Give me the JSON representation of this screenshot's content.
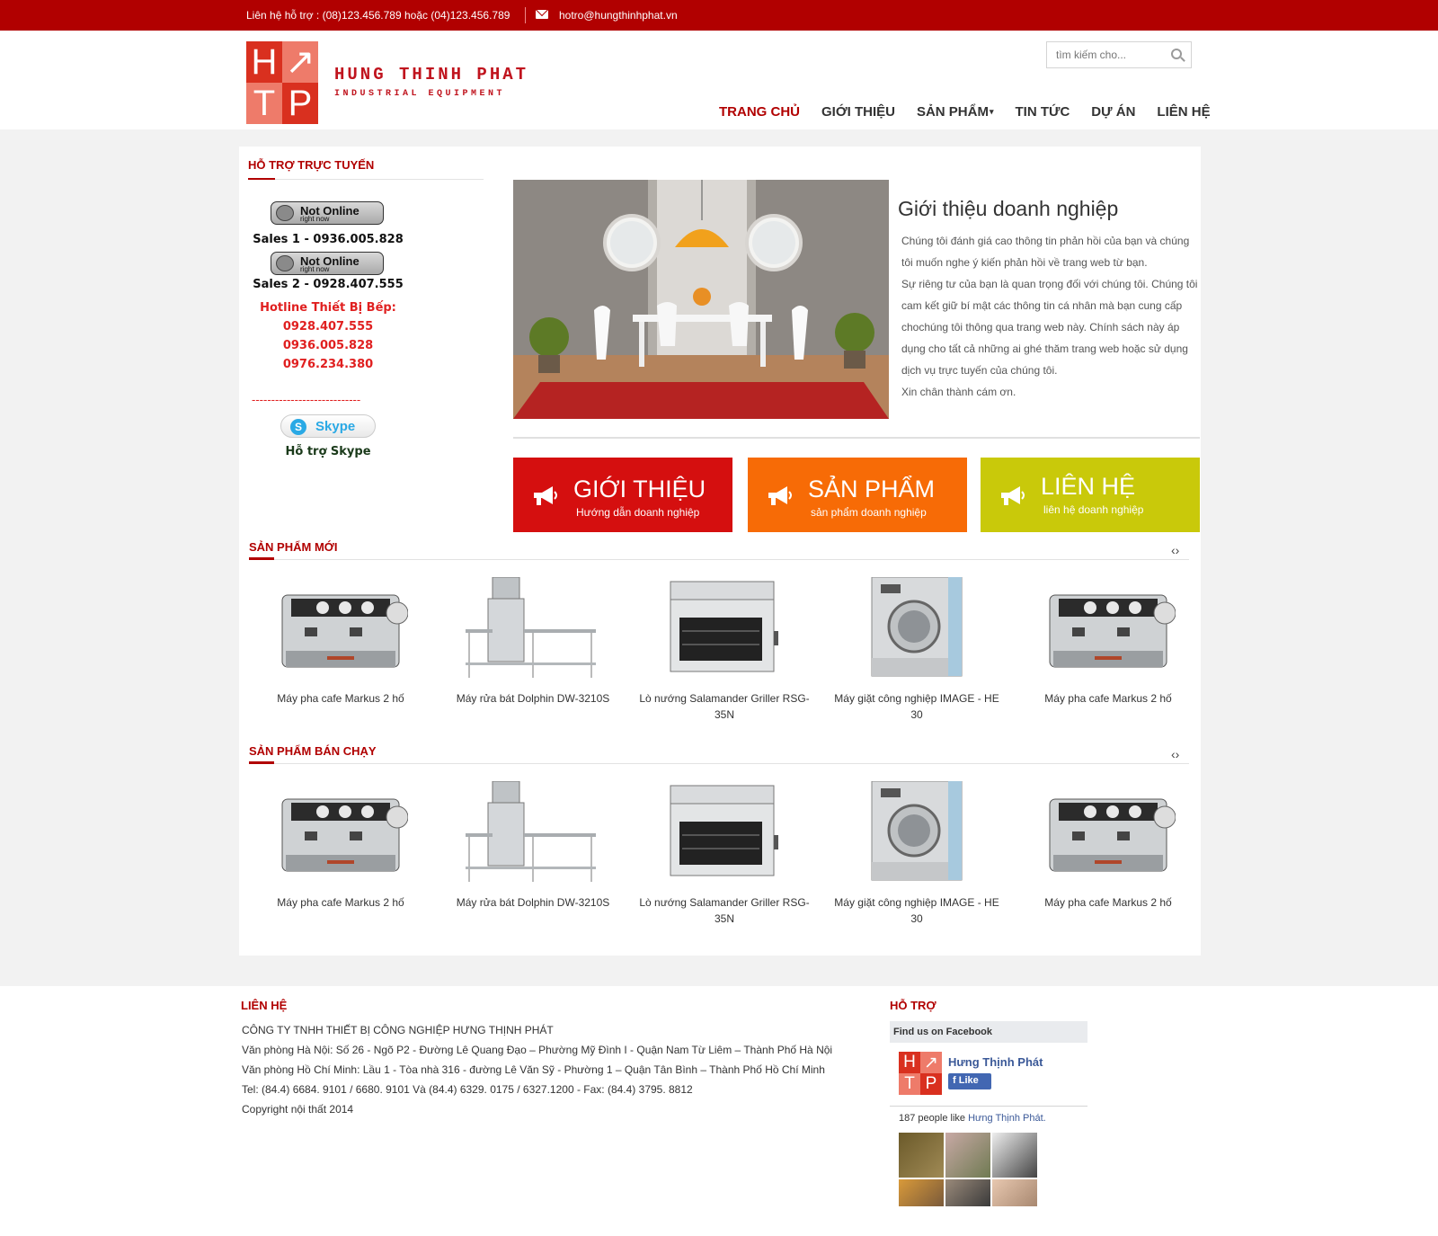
{
  "topbar": {
    "phone_text": "Liên hệ hỗ trợ :  (08)123.456.789 hoặc (04)123.456.789",
    "email": "hotro@hungthinhphat.vn"
  },
  "header": {
    "logo_letters": [
      "H",
      "↗",
      "T",
      "P"
    ],
    "brand_name": "HUNG THINH PHAT",
    "brand_sub": "INDUSTRIAL EQUIPMENT",
    "search_placeholder": "tìm kiếm cho...",
    "nav": [
      {
        "label": "TRANG CHỦ",
        "active": true
      },
      {
        "label": "GIỚI THIỆU"
      },
      {
        "label": "SẢN PHẨM",
        "has_dropdown": true
      },
      {
        "label": "TIN TỨC"
      },
      {
        "label": "DỰ ÁN"
      },
      {
        "label": "LIÊN HỆ"
      }
    ]
  },
  "sidebar": {
    "title": "HỖ TRỢ TRỰC TUYẾN",
    "status_line1": "Not Online",
    "status_line2": "right now",
    "sales1": "Sales 1 - 0936.005.828",
    "sales2": "Sales 2 - 0928.407.555",
    "hotline_title": "Hotline Thiết Bị Bếp:",
    "hotlines": [
      "0928.407.555",
      "0936.005.828",
      "0976.234.380"
    ],
    "dashes": "----------------------------",
    "skype_label": "Skype",
    "skype_caption": "Hỗ trợ Skype"
  },
  "intro": {
    "title": "Giới thiệu doanh nghiệp",
    "paragraphs": [
      "Chúng tôi đánh giá cao thông tin phản hồi của bạn và chúng tôi muốn nghe ý kiến phản hồi về trang web từ bạn.",
      "Sự riêng tư của bạn là quan trọng đối với chúng tôi. Chúng tôi cam kết giữ bí mật các thông tin cá nhân mà bạn cung cấp chochúng tôi thông qua trang web này. Chính sách này áp dụng cho tất cả những ai ghé thăm trang web hoặc sử dụng dịch vụ trực tuyến của chúng tôi.",
      "Xin chân thành cám ơn."
    ]
  },
  "tiles": [
    {
      "title": "GIỚI THIỆU",
      "subtitle": "Hướng dẫn doanh nghiệp",
      "color": "#d50f0f"
    },
    {
      "title": "SẢN PHẨM",
      "subtitle": "sản phẩm doanh nghiệp",
      "color": "#f76b06"
    },
    {
      "title": "LIÊN HỆ",
      "subtitle": "liên hệ doanh nghiệp",
      "color": "#c9c90a"
    }
  ],
  "new_products": {
    "title": "SẢN PHẨM MỚI",
    "arrows": "‹›",
    "items": [
      {
        "name": "Máy pha cafe Markus 2 hố",
        "image": "espresso-machine"
      },
      {
        "name": "Máy rửa bát Dolphin DW-3210S",
        "image": "dishwasher"
      },
      {
        "name": "Lò nướng Salamander Griller RSG-35N",
        "image": "salamander-oven"
      },
      {
        "name": "Máy giặt công nghiệp IMAGE - HE 30",
        "image": "washing-machine"
      },
      {
        "name": "Máy pha cafe Markus 2 hố",
        "image": "espresso-machine"
      }
    ]
  },
  "best_sellers": {
    "title": "SẢN PHẨM BÁN CHẠY",
    "arrows": "‹›",
    "items": [
      {
        "name": "Máy pha cafe Markus 2 hố",
        "image": "espresso-machine"
      },
      {
        "name": "Máy rửa bát Dolphin DW-3210S",
        "image": "dishwasher"
      },
      {
        "name": "Lò nướng Salamander Griller RSG-35N",
        "image": "salamander-oven"
      },
      {
        "name": "Máy giặt công nghiệp IMAGE - HE 30",
        "image": "washing-machine"
      },
      {
        "name": "Máy pha cafe Markus 2 hố",
        "image": "espresso-machine"
      }
    ]
  },
  "footer": {
    "contact_title": "LIÊN HỆ",
    "lines": [
      "CÔNG TY TNHH THIẾT BỊ CÔNG NGHIỆP HƯNG THỊNH PHÁT",
      "Văn phòng Hà Nội: Số 26 - Ngõ P2 - Đường Lê Quang Đạo – Phường Mỹ Đình I - Quận Nam Từ Liêm – Thành Phố Hà Nội",
      "Văn phòng Hồ Chí Minh: Lầu 1 - Tòa nhà 316 - đường Lê Văn Sỹ - Phường 1 – Quận Tân Bình – Thành Phố Hồ Chí Minh",
      "Tel: (84.4) 6684. 9101 / 6680. 9101 Và (84.4) 6329. 0175 / 6327.1200 - Fax: (84.4) 3795. 8812",
      "Copyright nội thất 2014"
    ],
    "support_title": "HỖ TRỢ",
    "facebook": {
      "header": "Find us on Facebook",
      "page_name": "Hưng Thịnh Phát",
      "like_label": "Like",
      "count_prefix": "187 people like ",
      "count_page": "Hưng Thịnh Phát."
    }
  },
  "colors": {
    "brand_red": "#b10000",
    "tile_red": "#d50f0f",
    "tile_orange": "#f76b06",
    "tile_olive": "#c9c90a",
    "facebook_blue": "#3b5998"
  }
}
